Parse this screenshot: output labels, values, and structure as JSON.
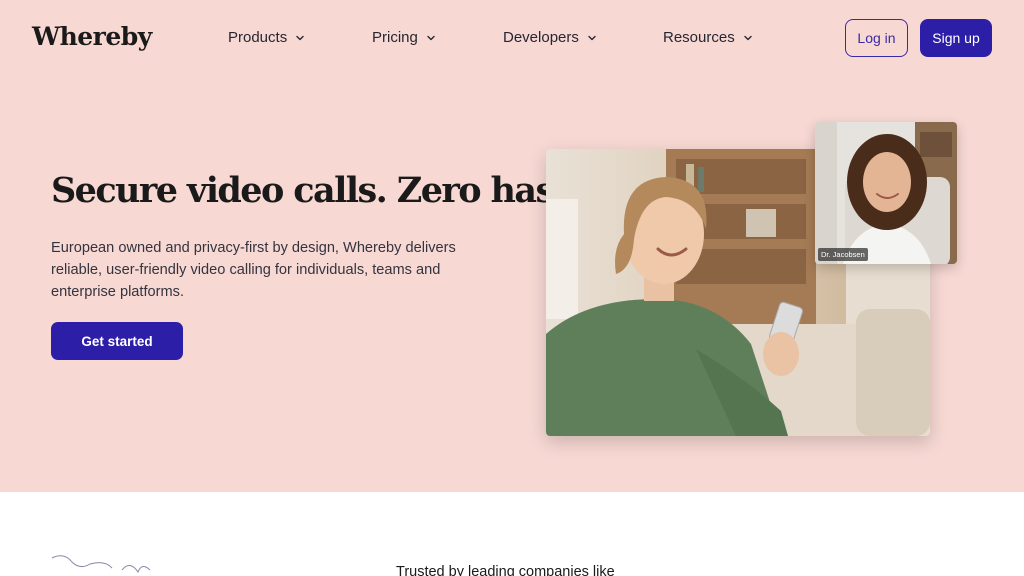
{
  "brand": {
    "name": "Whereby"
  },
  "nav": {
    "items": [
      {
        "label": "Products"
      },
      {
        "label": "Pricing"
      },
      {
        "label": "Developers"
      },
      {
        "label": "Resources"
      }
    ],
    "login_label": "Log in",
    "signup_label": "Sign up"
  },
  "hero": {
    "headline": "Secure video calls. Zero hassle",
    "description": "European owned and privacy-first by design, Whereby delivers reliable, user-friendly video calling for individuals, teams and enterprise platforms.",
    "cta_label": "Get started",
    "pip_participant": "Dr. Jacobsen"
  },
  "trusted": {
    "text": "Trusted by leading companies like"
  },
  "colors": {
    "hero_bg": "#f7d8d3",
    "accent": "#2d1ea8",
    "text": "#1a1a1a"
  },
  "icons": [
    "chevron-down-icon",
    "signature-scribble"
  ]
}
